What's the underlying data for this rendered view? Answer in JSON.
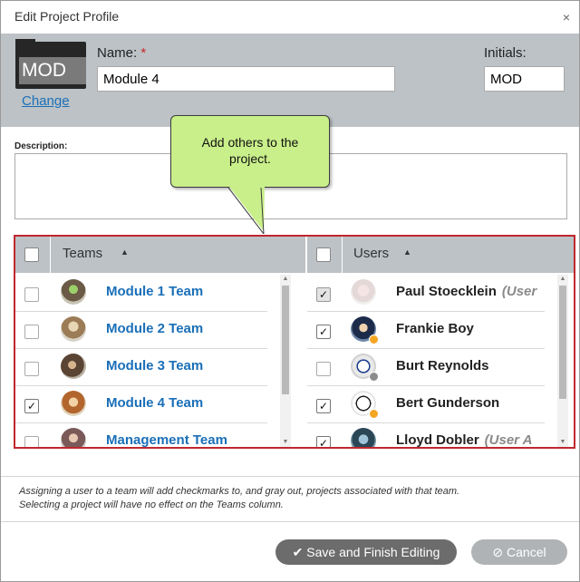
{
  "dialog": {
    "title": "Edit Project Profile",
    "close_icon": "×"
  },
  "profile": {
    "folder_text": "MOD",
    "change_label": "Change",
    "name_label": "Name:",
    "required_mark": "*",
    "name_value": "Module 4",
    "initials_label": "Initials:",
    "initials_value": "MOD",
    "description_label": "Description:"
  },
  "tooltip": {
    "text_line1": "Add others to the",
    "text_line2": "project."
  },
  "teams": {
    "header": "Teams",
    "sort_icon": "▲",
    "items": [
      {
        "name": "Module 1 Team",
        "checked": false
      },
      {
        "name": "Module 2 Team",
        "checked": false
      },
      {
        "name": "Module 3 Team",
        "checked": false
      },
      {
        "name": "Module 4 Team",
        "checked": true
      },
      {
        "name": "Management Team",
        "checked": false
      }
    ]
  },
  "users": {
    "header": "Users",
    "sort_icon": "▲",
    "items": [
      {
        "name": "Paul Stoecklein",
        "tag": "(User",
        "checked": true,
        "grayed": true
      },
      {
        "name": "Frankie Boy",
        "tag": "",
        "checked": true,
        "grayed": false,
        "status_color": "#f5a623"
      },
      {
        "name": "Burt Reynolds",
        "tag": "",
        "checked": false,
        "grayed": false,
        "status_color": "#8c8c8c"
      },
      {
        "name": "Bert Gunderson",
        "tag": "",
        "checked": true,
        "grayed": false,
        "status_color": "#f5a623"
      },
      {
        "name": "Lloyd Dobler",
        "tag": "(User A",
        "checked": true,
        "grayed": false
      }
    ]
  },
  "checkmark": "✓",
  "info": {
    "line1": "Assigning a user to a team will add checkmarks to, and gray out, projects associated with that team.",
    "line2": "Selecting a project will have no effect on the Teams column."
  },
  "buttons": {
    "save_label": "Save and Finish Editing",
    "save_icon": "✔",
    "cancel_label": "Cancel",
    "cancel_icon": "⊘"
  },
  "colors": {
    "accent_link": "#1a6fb8",
    "tooltip_bg": "#c9ef8a",
    "highlight_border": "#c0272d",
    "header_bg": "#bcc2c6"
  }
}
